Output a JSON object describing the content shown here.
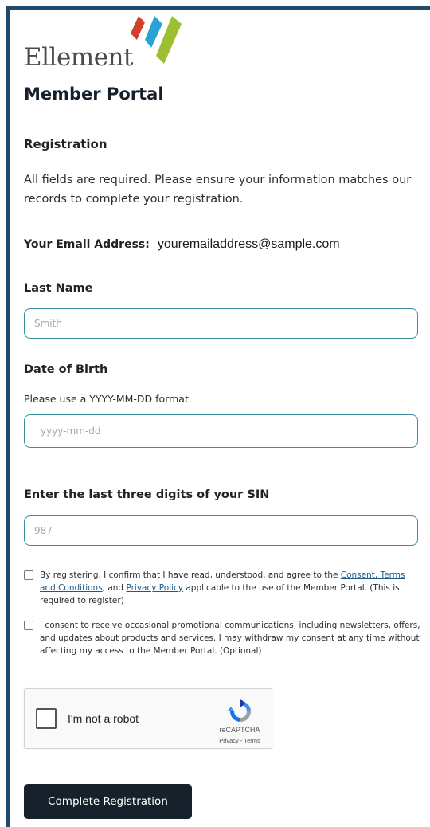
{
  "brand": {
    "logo_text": "Ellement",
    "colors": {
      "red": "#d2402e",
      "blue": "#2aa2d6",
      "green": "#9dc032"
    }
  },
  "header": {
    "title": "Member Portal"
  },
  "form": {
    "section_title": "Registration",
    "intro": "All fields are required. Please ensure your information matches our records to complete your registration.",
    "email": {
      "label": "Your Email Address:",
      "value": "youremailaddress@sample.com"
    },
    "last_name": {
      "label": "Last Name",
      "placeholder": "Smith"
    },
    "dob": {
      "label": "Date of Birth",
      "hint": "Please use a YYYY-MM-DD format.",
      "placeholder": "yyyy-mm-dd"
    },
    "sin": {
      "label": "Enter the last three digits of your SIN",
      "placeholder": "987"
    },
    "consent_terms": {
      "text_before": "By registering, I confirm that I have read, understood, and agree to the ",
      "link_terms": "Consent, Terms and Conditions",
      "text_middle": ", and ",
      "link_privacy": "Privacy Policy",
      "text_after": " applicable to the use of the Member Portal. (This is required to register)"
    },
    "consent_marketing": {
      "text": "I consent to receive occasional promotional communications, including newsletters, offers, and updates about products and services. I may withdraw my consent at any time without affecting my access to the Member Portal. (Optional)"
    },
    "captcha": {
      "label": "I'm not a robot",
      "brand": "reCAPTCHA",
      "links": "Privacy - Terms"
    },
    "submit_label": "Complete Registration"
  },
  "theme": {
    "frame": "#1f4a6a",
    "input_border": "#3a8f9e",
    "button_bg": "#16212b"
  }
}
